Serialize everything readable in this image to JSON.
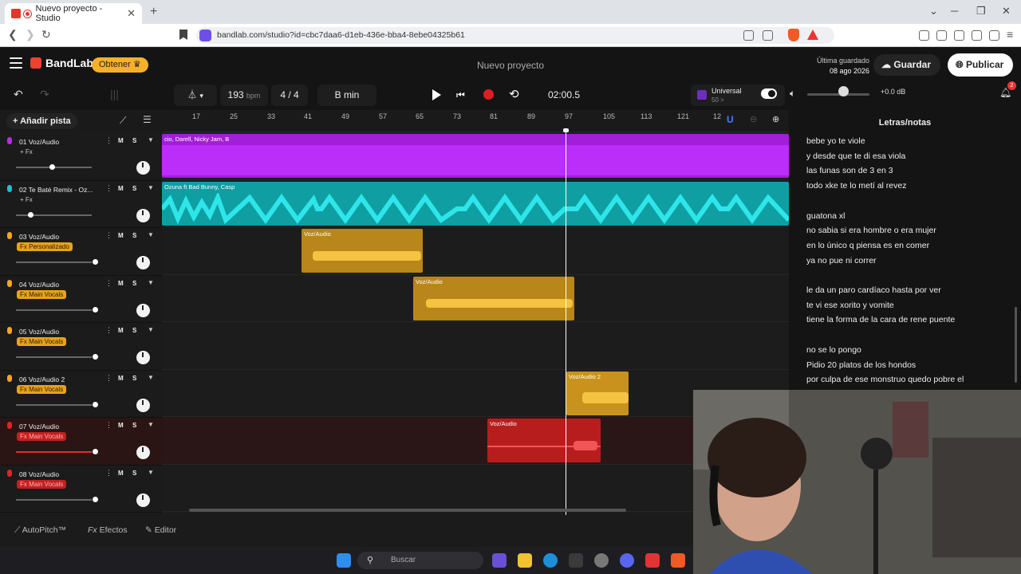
{
  "browser": {
    "tab_title": "Nuevo proyecto - Studio",
    "url": "bandlab.com/studio?id=cbc7daa6-d1eb-436e-bba4-8ebe04325b61"
  },
  "header": {
    "brand": "BandLab",
    "obtener": "Obtener",
    "project_title": "Nuevo proyecto",
    "saved_label": "Última guardado",
    "saved_date": "08 ago 2026",
    "save_button": "Guardar",
    "publish_button": "Publicar"
  },
  "transport": {
    "bpm": "193",
    "bpm_unit": "bpm",
    "time_sig": "4 / 4",
    "key": "B min",
    "time": "02:00.5",
    "preset_name": "Universal",
    "preset_sub": "50 >",
    "volume_readout": "+0.0 dB",
    "notification_count": "2"
  },
  "panel": {
    "add_track": "Añadir pista"
  },
  "ruler": [
    "17",
    "25",
    "33",
    "41",
    "49",
    "57",
    "65",
    "73",
    "81",
    "89",
    "97",
    "105",
    "113",
    "121",
    "12"
  ],
  "tracks": [
    {
      "name": "01  Voz/Audio",
      "fx": "+ Fx",
      "color": "#b92ce0"
    },
    {
      "name": "02  Te Baté Remix - Oz...",
      "fx": "+ Fx",
      "color": "#19c3c8"
    },
    {
      "name": "03  Voz/Audio",
      "fx": "Fx Personalizado",
      "color": "#f0a81a"
    },
    {
      "name": "04  Voz/Audio",
      "fx": "Fx Main Vocals",
      "color": "#f0a81a"
    },
    {
      "name": "05  Voz/Audio",
      "fx": "Fx Main Vocals",
      "color": "#f0a81a"
    },
    {
      "name": "06  Voz/Audio 2",
      "fx": "Fx Main Vocals",
      "color": "#f0a81a"
    },
    {
      "name": "07  Voz/Audio",
      "fx": "Fx Main Vocals",
      "color": "#e02424"
    },
    {
      "name": "08  Voz/Audio",
      "fx": "Fx Main Vocals",
      "color": "#e02424"
    }
  ],
  "track_controls": {
    "mute": "M",
    "solo": "S"
  },
  "clips": {
    "c1": "cio, Darell, Nicky Jam, B",
    "c2": "Ozuna ft Bad Bunny, Casp",
    "c3": "Voz/Audio",
    "c4": "Voz/Audio",
    "c6": "Voz/Audio 2",
    "c7": "Voz/Audio"
  },
  "lyrics": {
    "title": "Letras/notas",
    "lines": [
      "bebe yo te viole",
      "y desde que te di esa viola",
      "las funas son de 3 en 3",
      "todo xke te lo metí al revez",
      "",
      "guatona xl",
      "no sabia si era hombre o era mujer",
      "en lo único q piensa es en comer",
      "ya no pue ni correr",
      "",
      "le da un paro cardíaco hasta por ver",
      "te vi ese xorito y vomite",
      "tiene la forma de la cara de rene puente",
      "",
      "no se lo pongo",
      "Pidio 20 platos de los hondos",
      "por culpa de ese monstruo quedo pobre el"
    ]
  },
  "bottom": {
    "autopitch": "AutoPitch™",
    "efectos": "Efectos",
    "editor": "Editor",
    "fx_prefix": "Fx"
  },
  "taskbar": {
    "search": "Buscar"
  }
}
